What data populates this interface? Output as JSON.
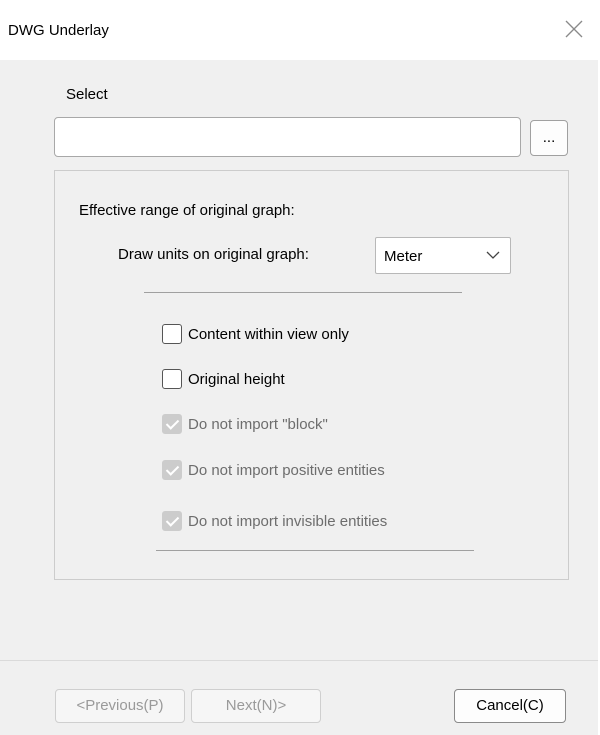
{
  "window": {
    "title": "DWG Underlay"
  },
  "select": {
    "label": "Select",
    "path_value": "",
    "browse_label": "..."
  },
  "group": {
    "range_label": "Effective range of original graph:",
    "units_label": "Draw units on original graph:",
    "units_value": "Meter"
  },
  "options": [
    {
      "label": "Content within view only",
      "checked": false,
      "enabled": true
    },
    {
      "label": "Original height",
      "checked": false,
      "enabled": true
    },
    {
      "label": "Do not import \"block\"",
      "checked": true,
      "enabled": false
    },
    {
      "label": "Do not import positive entities",
      "checked": true,
      "enabled": false
    },
    {
      "label": "Do not import invisible entities",
      "checked": true,
      "enabled": false
    }
  ],
  "buttons": {
    "previous": "<Previous(P)",
    "next": "Next(N)>",
    "cancel": "Cancel(C)"
  }
}
